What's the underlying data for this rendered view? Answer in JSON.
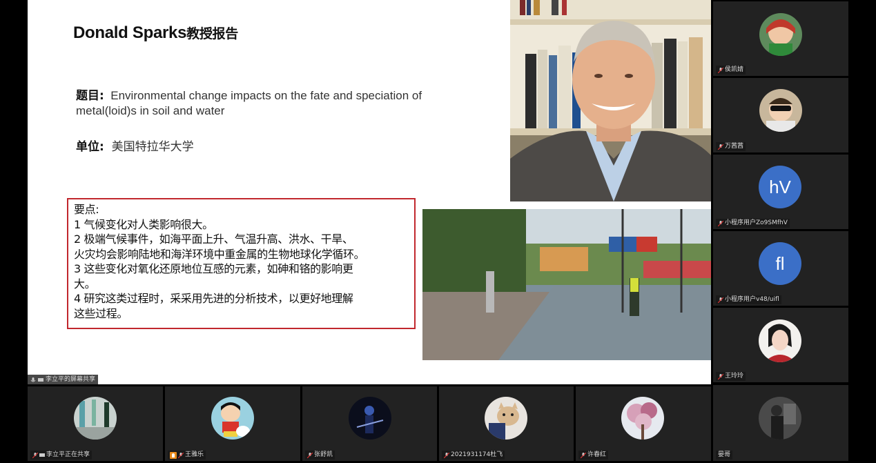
{
  "slide": {
    "title_en": "Donald Sparks",
    "title_cn": "教授报告",
    "topic_label": "题目:",
    "topic_text": "Environmental change impacts on the fate and speciation of metal(loid)s in soil and water",
    "unit_label": "单位:",
    "unit_text": "美国特拉华大学",
    "keypoints": {
      "header": "要点:",
      "lines": [
        "1 气候变化对人类影响很大。",
        "2 极端气候事件，如海平面上升、气温升高、洪水、干旱、",
        "火灾均会影响陆地和海洋环境中重金属的生物地球化学循环。",
        "3 这些变化对氧化还原地位互感的元素，如砷和铬的影响更",
        "大。",
        "4 研究这类过程时，采采用先进的分析技术，以更好地理解",
        "这些过程。"
      ]
    }
  },
  "presenter_badge": "李立平的屏幕共享",
  "right_column": [
    {
      "name": "侯凯婧",
      "avatar": "cartoon-red-hair",
      "initials": ""
    },
    {
      "name": "万茜茜",
      "avatar": "child-sunglasses",
      "initials": ""
    },
    {
      "name": "小程序用户Zo9SMfhV",
      "avatar": "letters",
      "initials": "hV"
    },
    {
      "name": "小程序用户v48/uifl",
      "avatar": "letters",
      "initials": "fl"
    },
    {
      "name": "王玲玲",
      "avatar": "woman-portrait",
      "initials": ""
    },
    {
      "name": "晏哥",
      "avatar": "person-dark",
      "initials": ""
    }
  ],
  "bottom_row": [
    {
      "name": "李立平正在共享",
      "avatar": "room-photo"
    },
    {
      "name": "王雅乐",
      "avatar": "crayon-shin"
    },
    {
      "name": "张舒凯",
      "avatar": "guitarist-dark"
    },
    {
      "name": "2021931174杜飞",
      "avatar": "cat-photo"
    },
    {
      "name": "许春红",
      "avatar": "flowers-tree"
    }
  ],
  "colors": {
    "keypoint_border": "#c1272d",
    "tile_bg": "#222222",
    "letter_avatar": "#3b6fc7"
  }
}
